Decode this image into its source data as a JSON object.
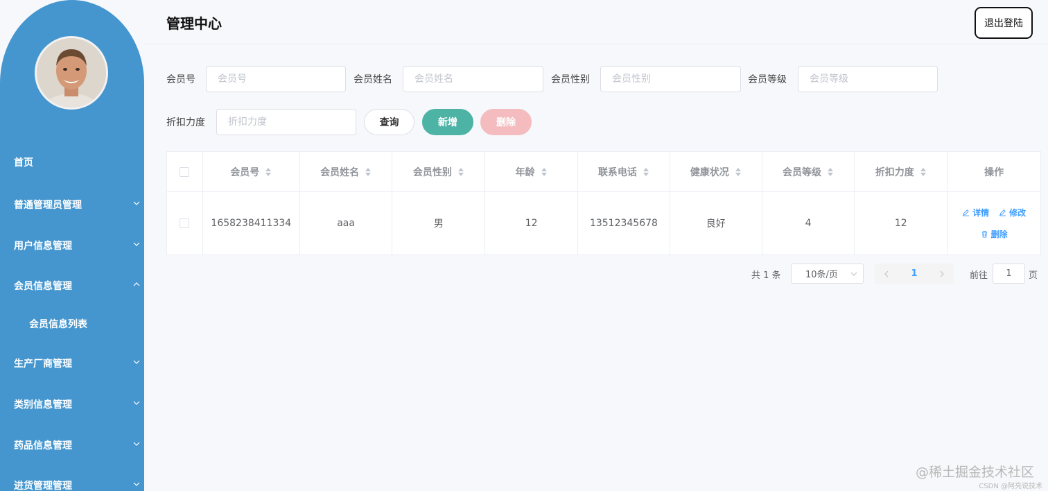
{
  "sidebar": {
    "menu": [
      {
        "label": "首页",
        "arrow": "none"
      },
      {
        "label": "普通管理员管理",
        "arrow": "chevron-down"
      },
      {
        "label": "用户信息管理",
        "arrow": "chevron-down"
      },
      {
        "label": "会员信息管理",
        "arrow": "chevron-up"
      },
      {
        "label": "会员信息列表",
        "arrow": "none"
      },
      {
        "label": "生产厂商管理",
        "arrow": "chevron-down"
      },
      {
        "label": "类别信息管理",
        "arrow": "chevron-down"
      },
      {
        "label": "药品信息管理",
        "arrow": "chevron-down"
      },
      {
        "label": "进货管理管理",
        "arrow": "chevron-down"
      }
    ],
    "accent": "#4596cf"
  },
  "header": {
    "title": "管理中心",
    "logout_label": "退出登陆"
  },
  "search": {
    "member_no_label": "会员号",
    "member_no_placeholder": "会员号",
    "member_name_label": "会员姓名",
    "member_name_placeholder": "会员姓名",
    "member_gender_label": "会员性别",
    "member_gender_placeholder": "会员性别",
    "member_level_label": "会员等级",
    "member_level_placeholder": "会员等级",
    "discount_label": "折扣力度",
    "discount_placeholder": "折扣力度",
    "query_label": "查询",
    "add_label": "新增",
    "delete_label": "删除"
  },
  "table": {
    "columns": [
      "会员号",
      "会员姓名",
      "会员性别",
      "年龄",
      "联系电话",
      "健康状况",
      "会员等级",
      "折扣力度",
      "操作"
    ],
    "rows": [
      {
        "member_no": "1658238411334",
        "name": "aaa",
        "gender": "男",
        "age": "12",
        "phone": "13512345678",
        "health": "良好",
        "level": "4",
        "discount": "12"
      }
    ],
    "actions": {
      "detail": "详情",
      "edit": "修改",
      "delete": "删除"
    }
  },
  "pagination": {
    "total": "共 1 条",
    "page_size": "10条/页",
    "current_page": "1",
    "goto_label": "前往",
    "goto_value": "1",
    "page_suffix": "页"
  },
  "watermark": {
    "main": "@稀土掘金技术社区",
    "sub": "CSDN @阿亮说技术"
  },
  "colors": {
    "primary": "#409eff",
    "add_button": "#4db3a4",
    "delete_button": "#f4bcbf"
  }
}
